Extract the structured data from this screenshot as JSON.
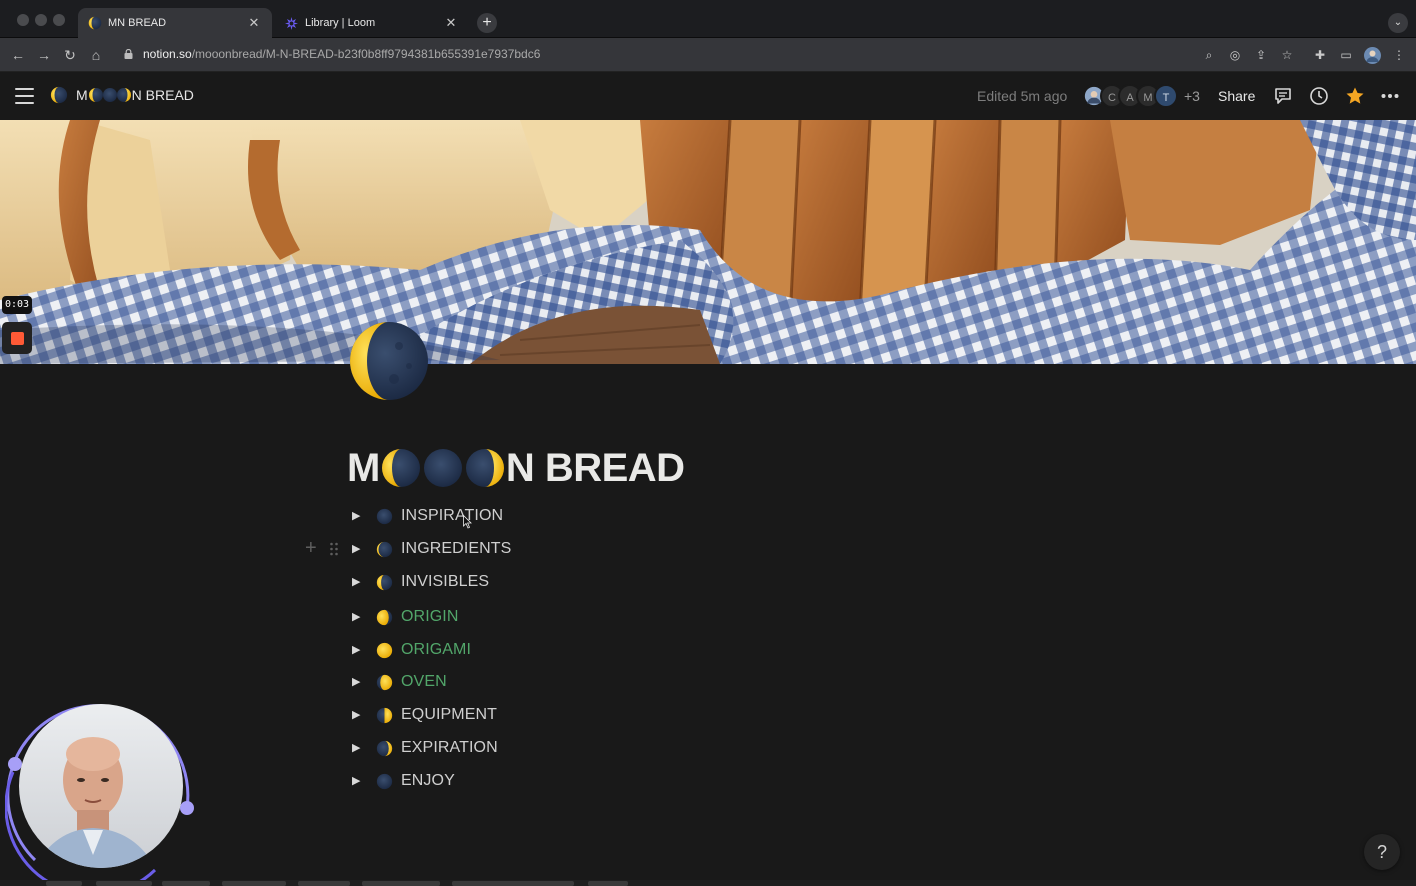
{
  "browser": {
    "tabs": [
      {
        "label": "MN BREAD",
        "active": true,
        "icon": "moon-favicon"
      },
      {
        "label": "Library | Loom",
        "active": false,
        "icon": "loom-favicon"
      }
    ],
    "new_tab": "+",
    "url_domain": "notion.so",
    "url_path": "/mooonbread/M-N-BREAD-b23f0b8ff9794381b655391e7937bdc6"
  },
  "topbar": {
    "breadcrumb": "M◐●◑N BREAD",
    "breadcrumb_prefix": "M",
    "breadcrumb_suffix": "N BREAD",
    "edited": "Edited 5m ago",
    "avatars": [
      "photo",
      "C",
      "A",
      "M",
      "T"
    ],
    "more_count": "+3",
    "share_label": "Share",
    "favorite_color": "#f5a623"
  },
  "loom": {
    "timer": "0:03",
    "stop_color": "#ff5a36",
    "ring_color": "#7b6cf0"
  },
  "page": {
    "title_prefix": "M",
    "title_suffix": "N BREAD",
    "toggles": [
      {
        "label": "INSPIRATION",
        "phase": "new",
        "green": false
      },
      {
        "label": "INGREDIENTS",
        "phase": "waxing-crescent-thin",
        "green": false
      },
      {
        "label": "INVISIBLES",
        "phase": "waxing-crescent",
        "green": false
      },
      {
        "label": "ORIGIN",
        "phase": "waxing-gibbous",
        "green": true
      },
      {
        "label": "ORIGAMI",
        "phase": "full",
        "green": true
      },
      {
        "label": "OVEN",
        "phase": "waning-gibbous",
        "green": true
      },
      {
        "label": "EQUIPMENT",
        "phase": "last-quarter",
        "green": false
      },
      {
        "label": "EXPIRATION",
        "phase": "waning-crescent",
        "green": false
      },
      {
        "label": "ENJOY",
        "phase": "new",
        "green": false
      }
    ]
  },
  "help_label": "?"
}
